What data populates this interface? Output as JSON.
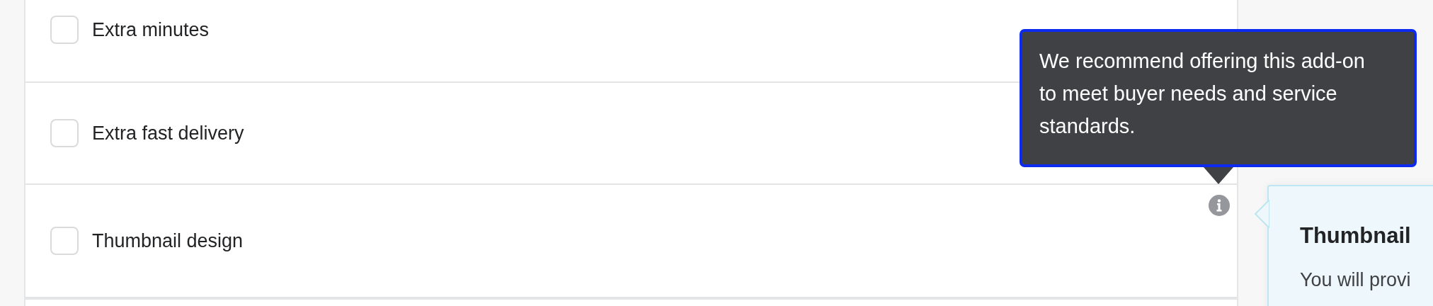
{
  "addons": [
    {
      "label": "Extra minutes",
      "checked": false,
      "info": false
    },
    {
      "label": "Extra fast delivery",
      "checked": false,
      "info": false
    },
    {
      "label": "Thumbnail design",
      "checked": false,
      "info": true
    }
  ],
  "tooltip": {
    "text": "We recommend offering this add-on to meet buyer needs and service standards."
  },
  "side_panel": {
    "title": "Thumbnail",
    "body": "You will provi"
  }
}
